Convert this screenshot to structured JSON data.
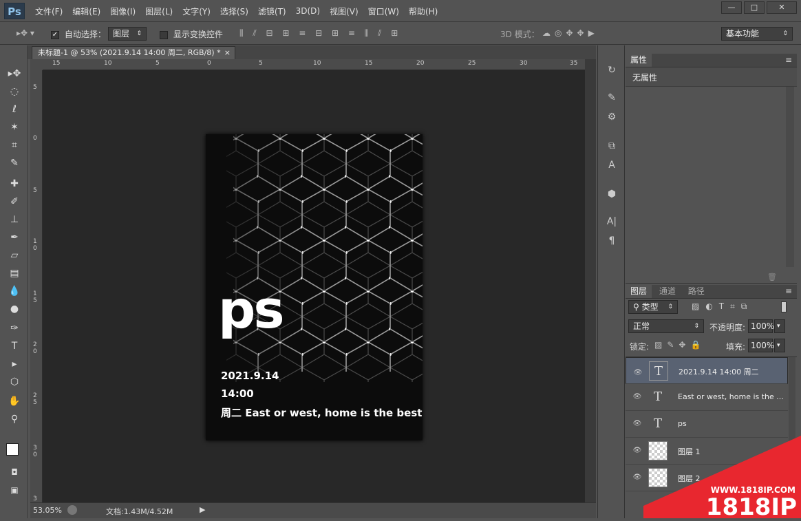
{
  "app": {
    "logo": "Ps"
  },
  "menu": [
    "文件(F)",
    "编辑(E)",
    "图像(I)",
    "图层(L)",
    "文字(Y)",
    "选择(S)",
    "滤镜(T)",
    "3D(D)",
    "视图(V)",
    "窗口(W)",
    "帮助(H)"
  ],
  "window_buttons": {
    "minimize": "—",
    "maximize": "□",
    "close": "✕"
  },
  "options": {
    "auto_select_label": "自动选择：",
    "auto_select_checked": "✓",
    "auto_select_value": "图层",
    "show_transform_label": "显示变换控件",
    "mode_3d_label": "3D 模式：",
    "workspace": "基本功能"
  },
  "document_tab": {
    "title": "未标题-1 @ 53% (2021.9.14 14:00 周二, RGB/8) *",
    "close": "×"
  },
  "ruler": {
    "h_ticks": [
      "15",
      "10",
      "5",
      "0",
      "5",
      "10",
      "15",
      "20",
      "25",
      "30",
      "35"
    ],
    "v_ticks": [
      "5",
      "0",
      "5",
      "1\n0",
      "1\n5",
      "2\n0",
      "2\n5",
      "3\n0",
      "3"
    ]
  },
  "document": {
    "big_text": "ps",
    "line1": "2021.9.14",
    "line2": "14:00",
    "line3": "周二  East or west, home is the best"
  },
  "status": {
    "zoom": "53.05%",
    "doc_info": "文档:1.43M/4.52M"
  },
  "properties_panel": {
    "tab": "属性",
    "content": "无属性"
  },
  "layers_panel": {
    "tabs": [
      "图层",
      "通道",
      "路径"
    ],
    "filter_label": "类型",
    "blend_mode": "正常",
    "opacity_label": "不透明度:",
    "opacity": "100%",
    "lock_label": "锁定:",
    "fill_label": "填充:",
    "fill": "100%",
    "layers": [
      {
        "name": "2021.9.14  14:00 周二",
        "type": "text"
      },
      {
        "name": "East or west, home is the ...",
        "type": "text"
      },
      {
        "name": "ps",
        "type": "text"
      },
      {
        "name": "图层 1",
        "type": "raster"
      },
      {
        "name": "图层 2",
        "type": "raster"
      }
    ]
  },
  "watermark": {
    "url": "WWW.1818IP.COM",
    "brand": "1818IP"
  },
  "colors": {
    "accent_selected_layer": "#596272",
    "watermark_red": "#e8272f"
  }
}
